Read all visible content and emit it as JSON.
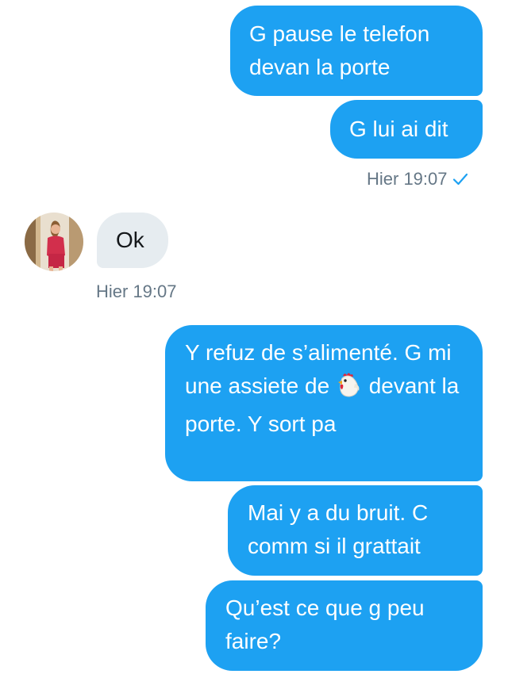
{
  "conversation": {
    "messages": [
      {
        "direction": "outgoing",
        "text": "G pause le telefon devan la porte"
      },
      {
        "direction": "outgoing",
        "text": "G lui ai dit"
      },
      {
        "direction": "incoming",
        "text": "Ok"
      },
      {
        "direction": "outgoing",
        "text_before_emoji": "Y refuz de s’alimenté. G mi une assiete de",
        "emoji": "chicken",
        "text_after_emoji": "devant la porte. Y sort pa"
      },
      {
        "direction": "outgoing",
        "text": "Mai y a du bruit. C comm si il grattait"
      },
      {
        "direction": "outgoing",
        "text": "Qu’est ce que g peu faire?"
      }
    ],
    "timestamps": {
      "outgoing_group": "Hier 19:07",
      "incoming": "Hier 19:07"
    },
    "read_receipt_icon": "checkmark-icon",
    "colors": {
      "outgoing_bubble": "#1da1f2",
      "incoming_bubble": "#e6ecf0",
      "timestamp_text": "#657786"
    }
  }
}
